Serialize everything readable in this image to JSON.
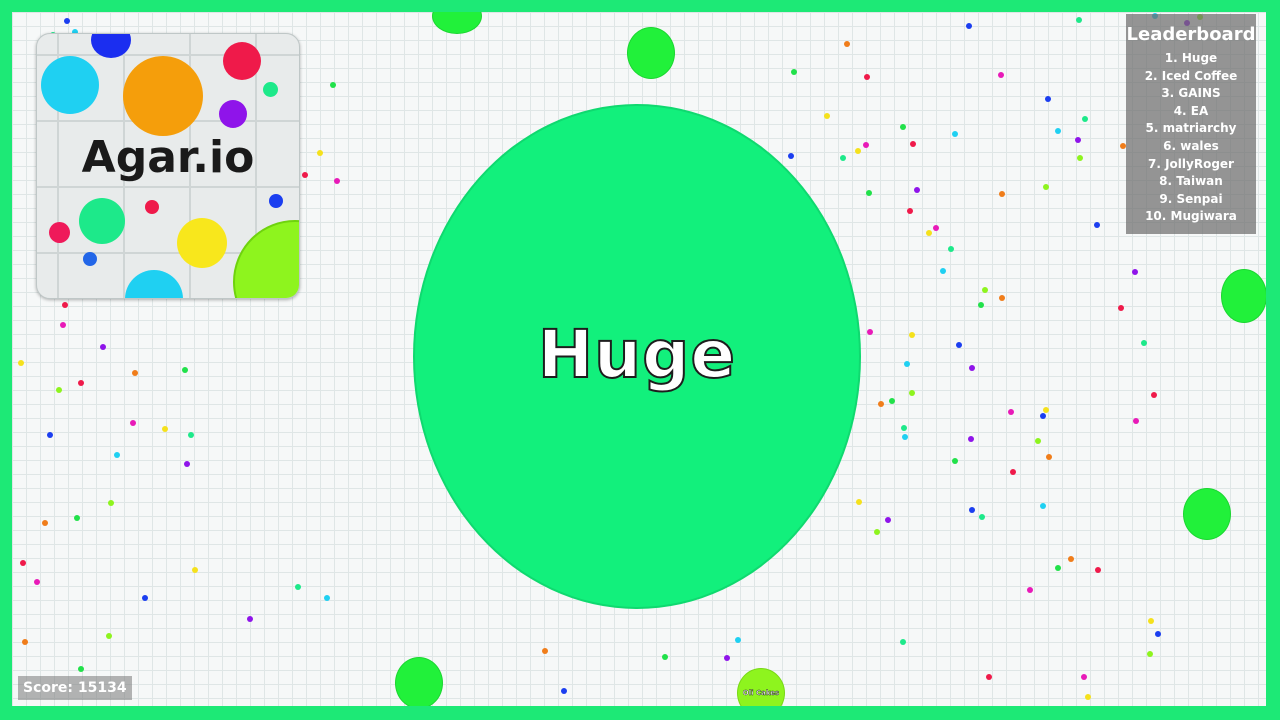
{
  "game": {
    "title": "Agar.io",
    "player_name": "Huge",
    "other_cell_name": "Oli Cakes",
    "score_text": "Score: 15134"
  },
  "leaderboard": {
    "title": "Leaderboard",
    "entries": [
      "1. Huge",
      "2. Iced Coffee",
      "3. GAINS",
      "4. EA",
      "5. matriarchy",
      "6. wales",
      "7. JollyRoger",
      "8. Taiwan",
      "9. Senpai",
      "10. Mugiwara"
    ]
  },
  "colors": {
    "frame_border": "#1de976",
    "player_cell": "#12f07c",
    "other_cells": "#21f13a",
    "yellow_green_cell": "#8ef41e",
    "background": "#f6f8f8"
  }
}
